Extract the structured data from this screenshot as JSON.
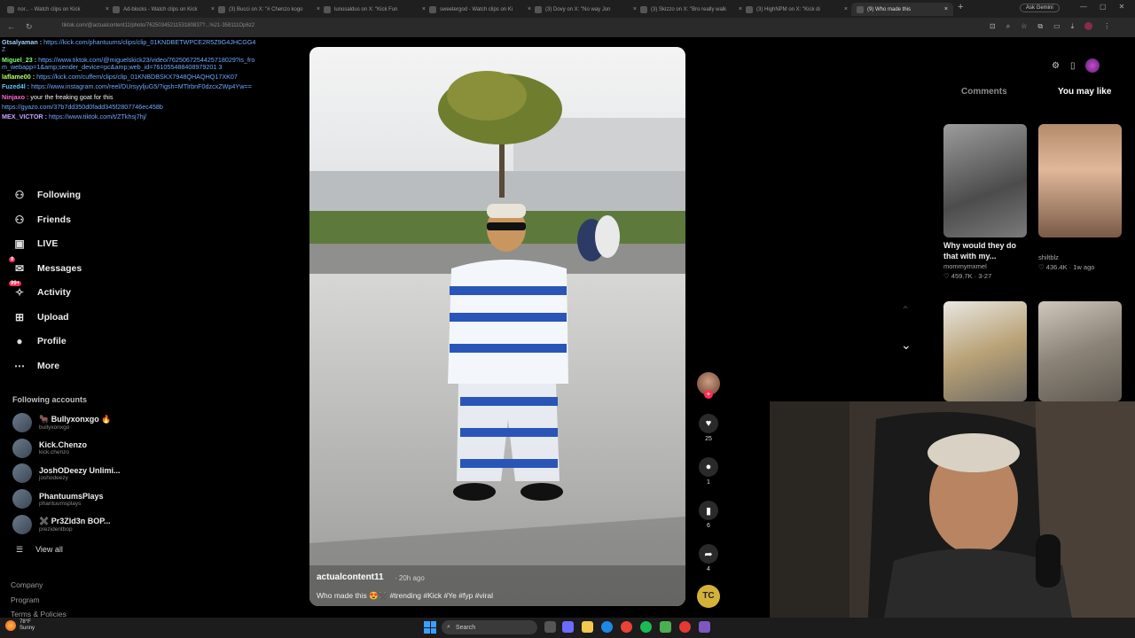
{
  "browser": {
    "tabs": [
      {
        "label": "nor... - Watch clips on Kick"
      },
      {
        "label": "Ad-blocks - Watch clips on Kick"
      },
      {
        "label": "(3) Bucci on X: \"# Chenzo kogo"
      },
      {
        "label": "lunosaldus on X: \"Kick Fun"
      },
      {
        "label": "sweetergod - Watch clips on Ki"
      },
      {
        "label": "(3) Dovy on X: \"No way Jon"
      },
      {
        "label": "(3) Skizzo on X: \"Bro really walk"
      },
      {
        "label": "(3) HighNPM on X: \"Kick di"
      },
      {
        "label": "(9) Who made this"
      }
    ],
    "new_tab": "+",
    "ask_gemini": "Ask Gemini",
    "window_controls": [
      "—",
      "▢",
      "✕"
    ],
    "url": "tiktok.com/@actualcontent11/photo/7625034521153180837?...%21-358111Op6z2"
  },
  "sidebar": {
    "nav": [
      {
        "icon": "following-icon",
        "label": "Following"
      },
      {
        "icon": "friends-icon",
        "label": "Friends"
      },
      {
        "icon": "live-icon",
        "label": "LIVE"
      },
      {
        "icon": "messages-icon",
        "label": "Messages",
        "badge": "9"
      },
      {
        "icon": "activity-icon",
        "label": "Activity",
        "badge": "99+"
      },
      {
        "icon": "upload-icon",
        "label": "Upload"
      },
      {
        "icon": "profile-icon",
        "label": "Profile"
      },
      {
        "icon": "more-icon",
        "label": "More"
      }
    ],
    "following_title": "Following accounts",
    "accounts": [
      {
        "name": "🐂 Bullyxonxgo 🔥",
        "handle": "bullyxonxgo"
      },
      {
        "name": "Kick.Chenzo",
        "handle": "kick.chenzo"
      },
      {
        "name": "JoshODeezy Unlimi...",
        "handle": "joshodeezy"
      },
      {
        "name": "PhantuumsPlays",
        "handle": "phantuumsplays"
      },
      {
        "name": "✖️ Pr3Zld3n BOP...",
        "handle": "prezidentbop"
      }
    ],
    "view_all": "View all",
    "footer": [
      "Company",
      "Program",
      "Terms & Policies"
    ]
  },
  "chat": [
    {
      "user": "Gtsalyaman :",
      "user_color": "#9fd0ff",
      "text": "https://kick.com/phantuums/clips/clip_01KNDBETWPCE2R5Z9G4JHCGG4Z",
      "link": true
    },
    {
      "user": "Miguel_23 :",
      "user_color": "#7dff7d",
      "text": "https://www.tiktok.com/@miguelskick23/video/7625067254425718029?is_from_webapp=1&amp;sender_device=pc&amp;web_id=761055488408979201 3",
      "link": true
    },
    {
      "user": "laflame00 :",
      "user_color": "#b5ff5e",
      "text": "https://kick.com/cuffem/clips/clip_01KNBDBSKX7948QHAQHQ17XK07",
      "link": true
    },
    {
      "user": "Fuzed4l :",
      "user_color": "#5ec8ff",
      "text": "https://www.instagram.com/reel/DUrsyyljuG5/?igsh=MTlrbnF0dzcxZWp4Yw==",
      "link": true
    },
    {
      "user": "Ninjaxo :",
      "user_color": "#ff6ad5",
      "text": "your the freaking goat for this",
      "link": false
    },
    {
      "user": "",
      "user_color": "#ffffff",
      "text": "https://gyazo.com/37b7dd350d0fadd345f2807746ec458b",
      "link": true
    },
    {
      "user": "MEX_VICTOR :",
      "user_color": "#c8a2ff",
      "text": "https://www.tiktok.com/t/ZTkhsj7hj/",
      "link": true
    }
  ],
  "video": {
    "author": "actualcontent11",
    "time": "· 20h ago",
    "caption": "Who made this 😍✖️ #trending #Kick #Ye #fyp #viral"
  },
  "actions": [
    {
      "icon": "heart-icon",
      "count": "25"
    },
    {
      "icon": "comment-icon",
      "count": "1"
    },
    {
      "icon": "bookmark-icon",
      "count": "6"
    },
    {
      "icon": "share-icon",
      "count": "4"
    }
  ],
  "right_panel": {
    "tab_comments": "Comments",
    "tab_you_may_like": "You may like",
    "cards": [
      {
        "title": "Why would they do that with my...",
        "user": "mommymxmel",
        "stats": "♡ 459.7K · 3-27"
      },
      {
        "title": "",
        "user": "shiltblz",
        "stats": "♡ 436.4K · 1w ago"
      },
      {
        "title": "",
        "user": "",
        "stats": ""
      },
      {
        "title": "",
        "user": "",
        "stats": ""
      }
    ]
  },
  "taskbar": {
    "temp": "78°F",
    "weather": "Sunny",
    "search_placeholder": "Search"
  },
  "colors": {
    "accent": "#fe2c55",
    "link": "#6fa8ff",
    "chat_bg": "rgba(0,0,0,0.55)"
  }
}
